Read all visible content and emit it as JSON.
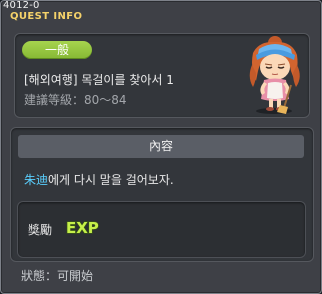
{
  "window": {
    "quest_id": "4012-0",
    "title": "QUEST INFO"
  },
  "quest": {
    "category": "一般",
    "name": "[해외여행] 목걸이를 찾아서 1",
    "level_label": "建議等級",
    "level_value": "80～84"
  },
  "content": {
    "header": "內容",
    "npc_name": "朱迪",
    "description_rest": "에게 다시 말을 걸어보자."
  },
  "reward": {
    "label": "獎勵",
    "item": "EXP"
  },
  "status": {
    "label": "狀態",
    "value": "可開始"
  },
  "colors": {
    "title": "#f5d26a",
    "badge": "#96c83f",
    "npc_link": "#5ad0ff",
    "exp_fill": "#c6f04a"
  },
  "icons": {
    "npc_portrait": "npc-girl-sprite",
    "exp": "exp-icon"
  }
}
